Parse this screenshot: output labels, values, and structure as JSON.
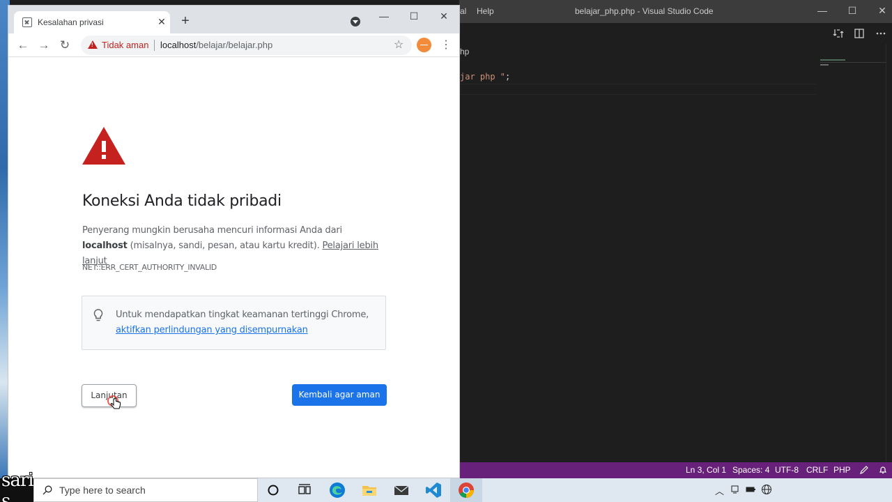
{
  "chrome": {
    "tab_title": "Kesalahan privasi",
    "tab_close": "✕",
    "new_tab": "+",
    "win_minimize": "—",
    "win_maximize": "☐",
    "win_close": "✕",
    "nav_back": "←",
    "nav_forward": "→",
    "nav_reload": "↻",
    "security_label": "Tidak aman",
    "url_host": "localhost",
    "url_path": "/belajar/belajar.php",
    "star_icon": "☆",
    "menu_icon": "⋮"
  },
  "error_page": {
    "heading": "Koneksi Anda tidak pribadi",
    "body_prefix": "Penyerang mungkin berusaha mencuri informasi Anda dari ",
    "body_host": "localhost",
    "body_suffix": " (misalnya, sandi, pesan, atau kartu kredit). ",
    "learn_more": "Pelajari lebih lanjut",
    "error_code": "NET::ERR_CERT_AUTHORITY_INVALID",
    "tip_text": "Untuk mendapatkan tingkat keamanan tertinggi Chrome, ",
    "tip_link": "aktifkan perlindungan yang disempurnakan",
    "advanced_button": "Lanjutan",
    "back_button": "Kembali agar aman"
  },
  "vscode": {
    "menu_partial": "al",
    "menu_help": "Help",
    "title": "belajar_php.php - Visual Studio Code",
    "win_minimize": "—",
    "win_maximize": "☐",
    "win_close": "✕",
    "breadcrumb": "hp",
    "code_string": "jar php \"",
    "code_semicolon": ";",
    "status": {
      "position": "Ln 3, Col 1",
      "spaces": "Spaces: 4",
      "encoding": "UTF-8",
      "eol": "CRLF",
      "language": "PHP"
    },
    "status_color": "#68217a"
  },
  "taskbar": {
    "watermark": "sari s",
    "search_placeholder": "Type here to search"
  },
  "colors": {
    "danger": "#c5221f",
    "primary": "#1a73e8"
  }
}
